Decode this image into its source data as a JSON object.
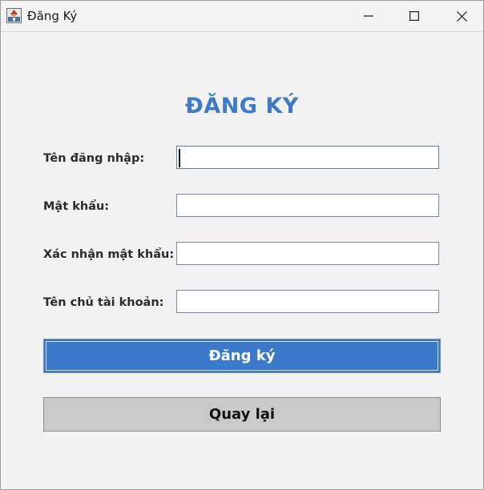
{
  "window": {
    "title": "Đăng Ký"
  },
  "form": {
    "heading": "ĐĂNG KÝ",
    "fields": [
      {
        "label": "Tên đăng nhập:",
        "value": "",
        "placeholder": ""
      },
      {
        "label": "Mật khẩu:",
        "value": "",
        "placeholder": ""
      },
      {
        "label": "Xác nhận mật khẩu:",
        "value": "",
        "placeholder": ""
      },
      {
        "label": "Tên chủ tài khoản:",
        "value": "",
        "placeholder": ""
      }
    ],
    "register_label": "Đăng ký",
    "back_label": "Quay lại"
  },
  "colors": {
    "accent": "#3b79cb",
    "heading": "#3d7bc9",
    "secondary_button": "#c9c9c9"
  },
  "icons": {
    "app": "java-app-icon",
    "minimize": "minimize-icon",
    "maximize": "maximize-icon",
    "close": "close-icon"
  }
}
